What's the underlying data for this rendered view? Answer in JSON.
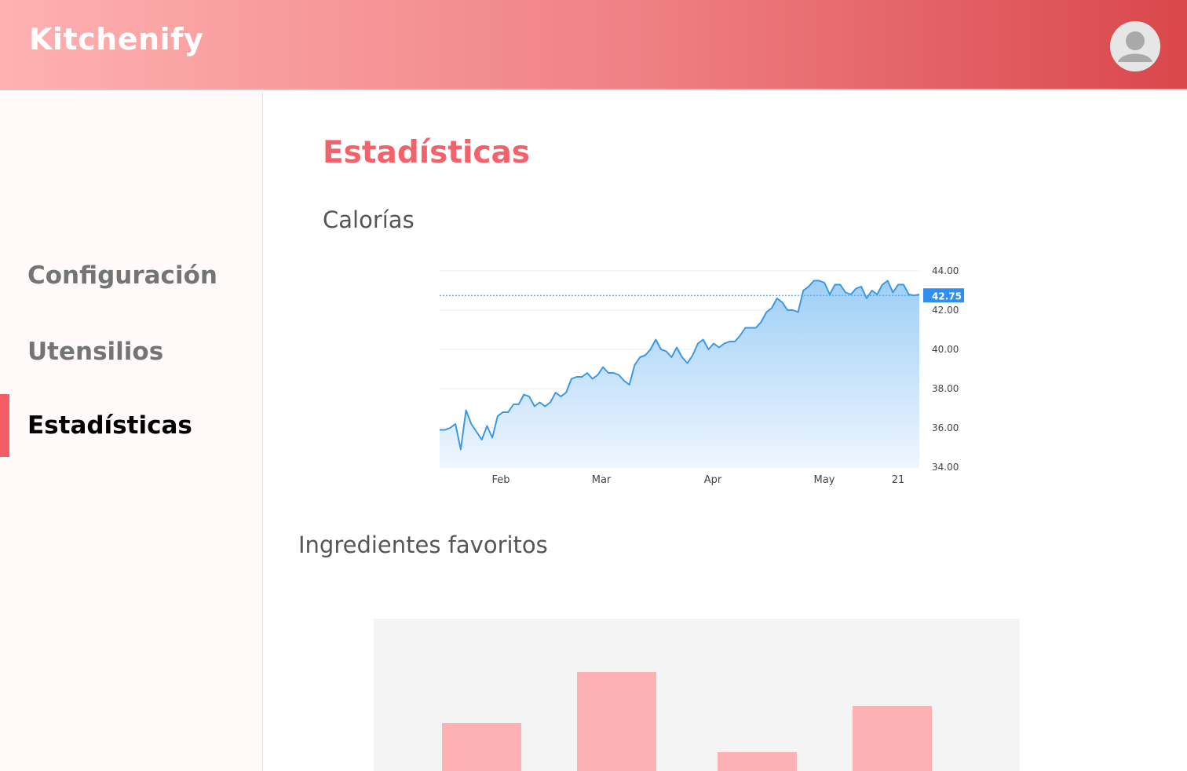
{
  "header": {
    "brand": "Kitchenify",
    "avatar_icon": "user-avatar-icon"
  },
  "sidebar": {
    "items": [
      {
        "label": "Configuración",
        "active": false
      },
      {
        "label": "Utensilios",
        "active": false
      },
      {
        "label": "Estadísticas",
        "active": true
      }
    ]
  },
  "main": {
    "title": "Estadísticas",
    "calories_title": "Calorías",
    "ingredients_title": "Ingredientes favoritos"
  },
  "colors": {
    "brand_accent": "#f3616a",
    "line": "#3a98e6",
    "bar": "#feb1b2"
  },
  "chart_data": [
    {
      "type": "area",
      "title": "Calorías",
      "x_tick_labels": [
        "Feb",
        "Mar",
        "Apr",
        "May",
        "21"
      ],
      "y_tick_labels": [
        "44.00",
        "42.00",
        "40.00",
        "38.00",
        "36.00",
        "34.00"
      ],
      "ylim": [
        34,
        44.2
      ],
      "current_value_label": "42.75",
      "current_value": 42.75,
      "grid": true,
      "series": [
        {
          "values": [
            35.9,
            35.9,
            36.0,
            36.2,
            34.9,
            36.9,
            36.2,
            35.8,
            35.4,
            36.1,
            35.5,
            36.6,
            36.8,
            36.8,
            37.2,
            37.2,
            37.7,
            37.6,
            37.1,
            37.3,
            37.1,
            37.3,
            37.8,
            37.6,
            37.8,
            38.5,
            38.6,
            38.6,
            38.8,
            38.5,
            38.7,
            39.1,
            38.8,
            38.8,
            38.7,
            38.4,
            38.2,
            39.2,
            39.6,
            39.7,
            40.0,
            40.5,
            40.0,
            39.9,
            39.6,
            40.1,
            39.6,
            39.3,
            39.7,
            40.3,
            40.5,
            40.0,
            40.3,
            40.1,
            40.3,
            40.4,
            40.4,
            40.7,
            41.1,
            41.1,
            41.1,
            41.4,
            41.9,
            42.1,
            42.6,
            42.4,
            42.0,
            42.0,
            41.9,
            43.0,
            43.2,
            43.5,
            43.5,
            43.4,
            42.8,
            43.3,
            43.3,
            42.9,
            42.8,
            43.1,
            43.2,
            42.6,
            43.0,
            42.8,
            43.3,
            43.5,
            42.9,
            43.3,
            43.3,
            42.8,
            42.75,
            42.8
          ]
        }
      ]
    },
    {
      "type": "bar",
      "title": "Ingredientes favoritos",
      "series": [
        {
          "values": [
            61,
            126,
            24,
            83
          ]
        }
      ]
    }
  ]
}
